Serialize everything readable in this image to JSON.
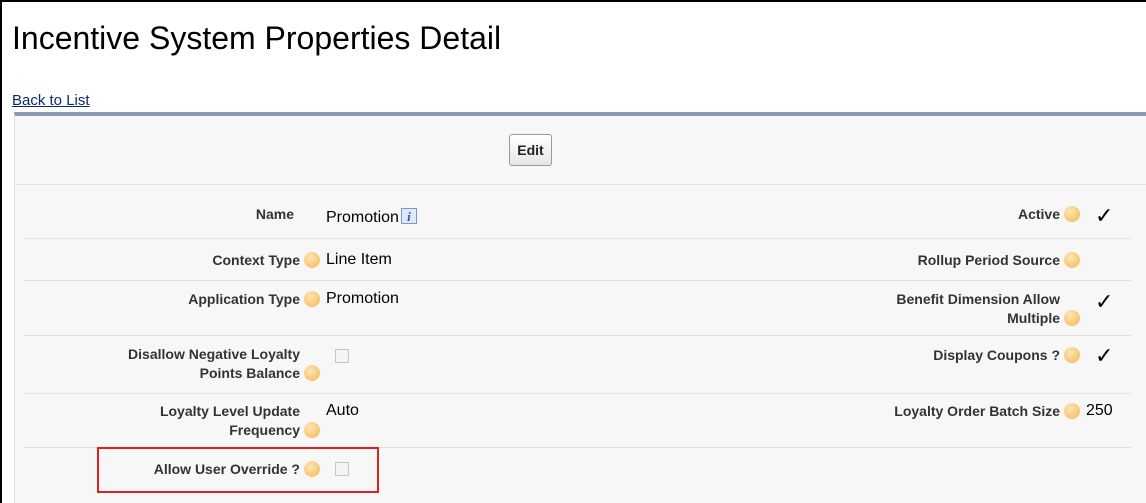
{
  "page": {
    "title": "Incentive System Properties Detail",
    "back_link": "Back to List"
  },
  "toolbar": {
    "edit_label": "Edit"
  },
  "icons": {
    "help": "help-icon",
    "info": "info-icon",
    "check": "checkmark-icon"
  },
  "fields": {
    "name": {
      "label": "Name",
      "value": "Promotion"
    },
    "active": {
      "label": "Active",
      "checked": true
    },
    "context_type": {
      "label": "Context Type",
      "value": "Line Item"
    },
    "rollup_period_source": {
      "label": "Rollup Period Source",
      "value": ""
    },
    "application_type": {
      "label": "Application Type",
      "value": "Promotion"
    },
    "benefit_dimension_allow_multiple": {
      "label_line1": "Benefit Dimension Allow",
      "label_line2": "Multiple",
      "checked": true
    },
    "disallow_negative_loyalty": {
      "label_line1": "Disallow Negative Loyalty",
      "label_line2": "Points Balance",
      "checked": false
    },
    "display_coupons": {
      "label": "Display Coupons ?",
      "checked": true
    },
    "loyalty_level_update_frequency": {
      "label_line1": "Loyalty Level Update",
      "label_line2": "Frequency",
      "value": "Auto"
    },
    "loyalty_order_batch_size": {
      "label": "Loyalty Order Batch Size",
      "value": "250"
    },
    "allow_user_override": {
      "label": "Allow User Override ?",
      "checked": false
    }
  },
  "colors": {
    "highlight_border": "#e02020",
    "panel_accent": "#8a9aaf",
    "link": "#0a2a6b"
  },
  "checkmark_glyph": "✓"
}
